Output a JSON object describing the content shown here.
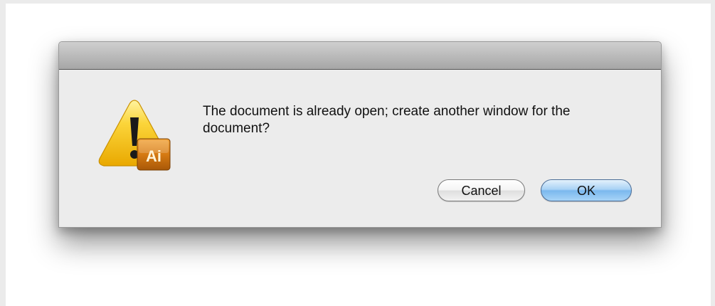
{
  "dialog": {
    "message": "The document is already open; create another window for the document?",
    "icon": "warning-triangle-icon",
    "app_badge_text": "Ai",
    "buttons": {
      "cancel_label": "Cancel",
      "ok_label": "OK"
    }
  },
  "colors": {
    "warning_yellow": "#f6c70c",
    "app_badge_orange": "#d67a12",
    "default_button_blue": "#7bb8ee"
  }
}
